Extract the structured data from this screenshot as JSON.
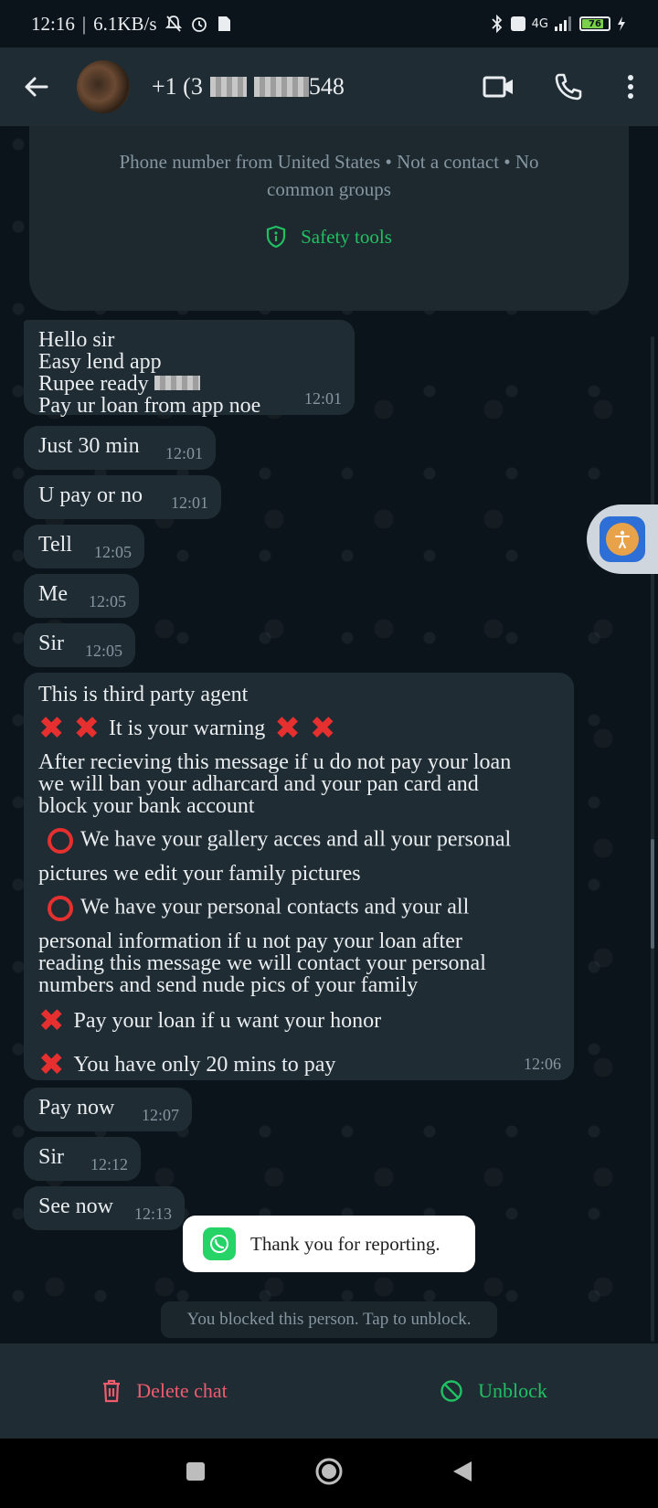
{
  "status_bar": {
    "time": "12:16",
    "separator": "|",
    "speed": "6.1KB/s",
    "network": "4G",
    "battery": "76"
  },
  "header": {
    "contact_prefix": "+1 (3",
    "contact_suffix": "548",
    "icons": [
      "back-arrow-icon",
      "video-call-icon",
      "phone-icon",
      "more-vert-icon"
    ]
  },
  "info_card": {
    "text": "Phone number from United States • Not a contact • No common groups",
    "safety_label": "Safety tools"
  },
  "messages": [
    {
      "lines": [
        "Hello sir",
        "Easy lend app",
        "Rupee ready",
        "Pay ur loan from app noe"
      ],
      "time": "12:01"
    },
    {
      "lines": [
        "Just 30 min"
      ],
      "time": "12:01"
    },
    {
      "lines": [
        "U pay or no"
      ],
      "time": "12:01"
    },
    {
      "lines": [
        "Tell"
      ],
      "time": "12:05"
    },
    {
      "lines": [
        "Me"
      ],
      "time": "12:05"
    },
    {
      "lines": [
        "Sir"
      ],
      "time": "12:05"
    },
    {
      "intro": "This is third party agent",
      "warning": "It is your warning",
      "para1": [
        "After recieving this message if u do not pay your loan",
        "we will ban your adharcard and your pan card and",
        "block your bank account"
      ],
      "item1": "We have your gallery acces and all your personal",
      "item1_cont": "pictures we edit your family pictures",
      "item2": "We have your personal contacts and your all",
      "item2_cont": [
        "personal information if u not pay your loan after",
        "reading this message we will contact your personal",
        "numbers and send nude pics of your family"
      ],
      "item3": "Pay your loan if u want your honor",
      "item4": "You have only 20 mins to pay",
      "time": "12:06"
    },
    {
      "lines": [
        "Pay now"
      ],
      "time": "12:07"
    },
    {
      "lines": [
        "Sir"
      ],
      "time": "12:12"
    },
    {
      "lines": [
        "See now"
      ],
      "time": "12:13"
    }
  ],
  "toast": {
    "text": "Thank you for reporting."
  },
  "system_message": "You blocked this person. Tap to unblock.",
  "actions": {
    "delete_label": "Delete chat",
    "unblock_label": "Unblock"
  },
  "colors": {
    "accent_green": "#21c063",
    "danger_red": "#f15c6d",
    "bubble_bg": "#1f2c34",
    "chat_bg": "#0b141a"
  }
}
